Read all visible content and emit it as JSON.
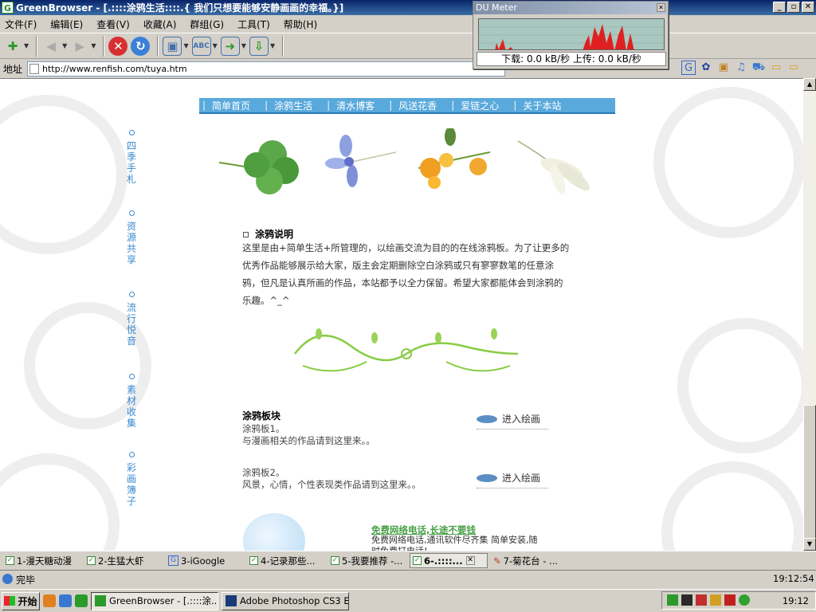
{
  "window": {
    "title": "GreenBrowser - [.::::涂鸦生活::::.{ 我们只想要能够安静画画的幸福。}]"
  },
  "menubar": [
    "文件(F)",
    "编辑(E)",
    "查看(V)",
    "收藏(A)",
    "群组(G)",
    "工具(T)",
    "帮助(H)"
  ],
  "address": {
    "label": "地址",
    "url": "http://www.renfish.com/tuya.htm"
  },
  "dumeter": {
    "title": "DU Meter",
    "readout": "下载: 0.0 kB/秒  上传: 0.0 kB/秒"
  },
  "page": {
    "nav": [
      "简单首页",
      "涂鸦生活",
      "清水博客",
      "风送花香",
      "爱链之心",
      "关于本站"
    ],
    "sidebar": [
      "四季手札",
      "资源共享",
      "流行悦音",
      "素材收集",
      "彩画簿子"
    ],
    "section_title": "涂鸦说明",
    "description": "这里是由+简单生活+所管理的，以绘画交流为目的的在线涂鸦板。为了让更多的优秀作品能够展示给大家，版主会定期删除空白涂鸦或只有寥寥数笔的任意涂鸦，但凡是认真所画的作品，本站都予以全力保留。希望大家都能体会到涂鸦的乐趣。^_^",
    "boards_title": "涂鸦板块",
    "boards": [
      {
        "name": "涂鸦板1。",
        "desc": "与漫画相关的作品请到这里来。。",
        "enter": "进入绘画"
      },
      {
        "name": "涂鸦板2。",
        "desc": "风景，心情，个性表现类作品请到这里来。。",
        "enter": "进入绘画"
      }
    ],
    "ad_title": "免费网络电话,长途不要钱",
    "ad_text": "免费网络电话,通讯软件尽齐集 简单安装,随时免费打电话!"
  },
  "tabs": [
    {
      "label": "1-漫天糖动漫",
      "icon": "check"
    },
    {
      "label": "2-生猛大虾",
      "icon": "check"
    },
    {
      "label": "3-iGoogle",
      "icon": "google"
    },
    {
      "label": "4-记录那些...",
      "icon": "check"
    },
    {
      "label": "5-我要推荐 -...",
      "icon": "check"
    },
    {
      "label": "6-.::::...",
      "icon": "check",
      "active": true
    },
    {
      "label": "7-菊花台 - ...",
      "icon": "pen"
    }
  ],
  "status": {
    "text": "完毕",
    "time": "19:12:54"
  },
  "taskbar": {
    "start": "开始",
    "tasks": [
      "GreenBrowser - [.::::涂...",
      "Adobe Photoshop CS3 E..."
    ],
    "clock": "19:12"
  },
  "colors": {
    "nav_bg": "#5aa9dc",
    "link": "#3a8ad0",
    "ad_green": "#48a048",
    "title_bg": "#0a246a"
  }
}
